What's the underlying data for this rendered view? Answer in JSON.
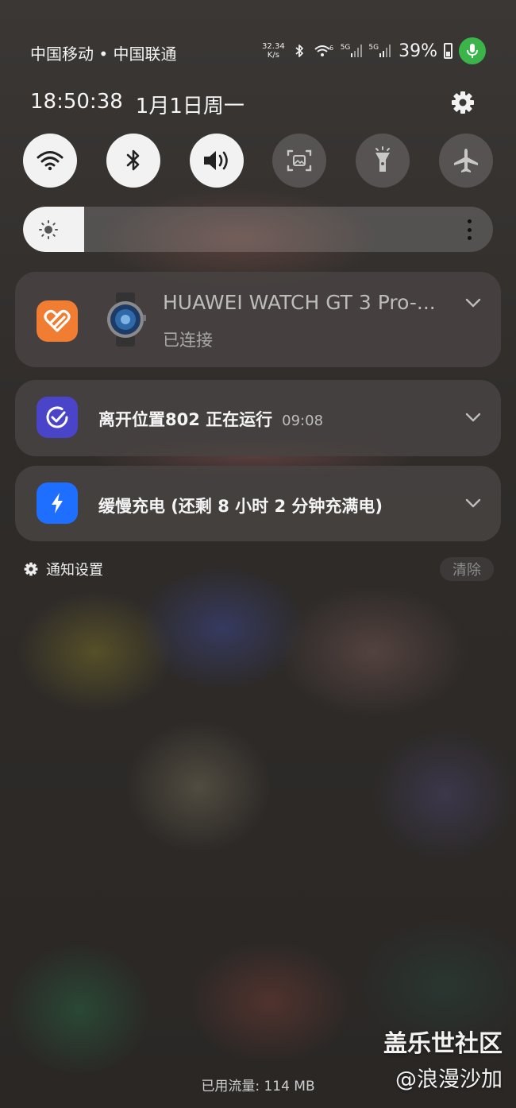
{
  "status_bar": {
    "carrier": "中国移动 • 中国联通",
    "net_speed_value": "32.34",
    "net_speed_unit": "K/s",
    "net1": "5G",
    "net2": "5G",
    "battery": "39%",
    "icons": [
      "bluetooth-icon",
      "wifi-6-icon",
      "signal-icon",
      "signal-icon",
      "battery-icon",
      "microphone-icon"
    ],
    "mic_color": "#3bb54a"
  },
  "header": {
    "time": "18:50:38",
    "date": "1月1日周一"
  },
  "quick_settings": [
    {
      "icon": "wifi-icon",
      "state": "on"
    },
    {
      "icon": "bluetooth-icon",
      "state": "on"
    },
    {
      "icon": "sound-icon",
      "state": "on"
    },
    {
      "icon": "screenshot-icon",
      "state": "off"
    },
    {
      "icon": "flashlight-icon",
      "state": "off"
    },
    {
      "icon": "airplane-icon",
      "state": "off"
    }
  ],
  "brightness": {
    "level_percent": 13
  },
  "notifications": [
    {
      "app": "huawei-health",
      "title": "HUAWEI WATCH GT 3 Pro-...",
      "subtitle": "已连接",
      "icon_color": "#f07d32"
    },
    {
      "app": "tasks",
      "title": "离开位置802 正在运行",
      "time": "09:08",
      "icon_color": "#4a44c8"
    },
    {
      "app": "charging",
      "title": "缓慢充电 (还剩 8 小时 2 分钟充满电)",
      "icon_color": "#1e6fff"
    }
  ],
  "footer": {
    "notification_settings": "通知设置",
    "clear": "清除",
    "data_usage": "已用流量: 114 MB"
  },
  "watermark": {
    "line1": "盖乐世社区",
    "line2": "@浪漫沙加"
  }
}
